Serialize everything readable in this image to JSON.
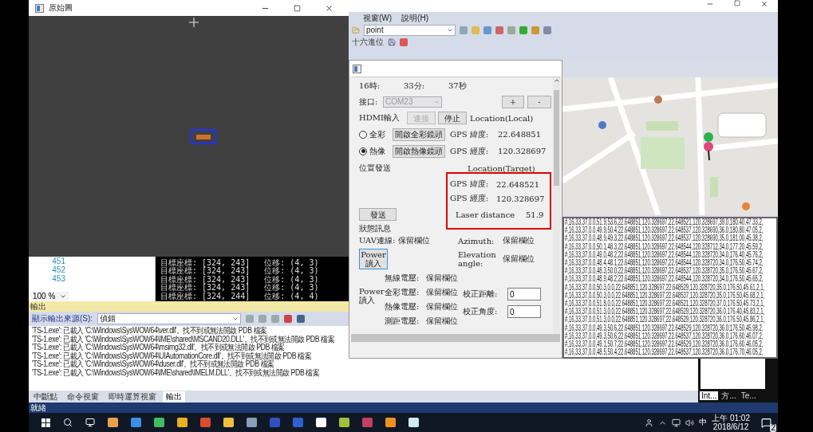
{
  "image_window": {
    "title": "原始圖"
  },
  "editor": {
    "line_numbers": [
      "451",
      "452",
      "453"
    ],
    "zoom": "100 %"
  },
  "console": {
    "lines": [
      "目標座標: [324, 243]   位移: (4, 3)",
      "目標座標: [324, 243]   位移: (4, 3)",
      "目標座標: [324, 243]   位移: (4, 3)",
      "目標座標: [324, 243]   位移: (4, 3)",
      "目標座標: [324, 244]   位移: (4, 4)"
    ]
  },
  "output": {
    "title": "輸出",
    "source_label": "顯示輸出來源(S):",
    "source": "偵錯",
    "lines": [
      "'TS-1.exe': 已載入 'C:\\Windows\\SysWOW64\\ver.dll'。找不到或無法開啟 PDB 檔案",
      "'TS-1.exe': 已載入 'C:\\Windows\\SysWOW64\\IME\\shared\\MSCAND20.DLL'。找不到或無法開啟 PDB 檔案",
      "'TS-1.exe': 已載入 'C:\\Windows\\SysWOW64\\msimg32.dll'。找不到或無法開啟 PDB 檔案",
      "'TS-1.exe': 已載入 'C:\\Windows\\SysWOW64\\UIAutomationCore.dll'。找不到或無法開啟 PDB 檔案",
      "'TS-1.exe': 已載入 'C:\\Windows\\SysWOW64\\duser.dll'。找不到或無法開啟 PDB 檔案",
      "'TS-1.exe': 已載入 'C:\\Windows\\SysWOW64\\IME\\shared\\IMELM.DLL'。找不到或無法開啟 PDB 檔案"
    ]
  },
  "vs": {
    "menu": [
      "視窗(W)",
      "說明(H)"
    ],
    "config": "point",
    "hex_label": "十六進位"
  },
  "dialog": {
    "time": [
      "16時:",
      "33分:",
      "37秒"
    ],
    "port_label": "接口:",
    "port": {
      "value": "COM23",
      "disabled": true
    },
    "plus": "+",
    "minus": "-",
    "hdmi_label": "HDMI輸入",
    "connect": {
      "label": "連接",
      "disabled": true
    },
    "stop": "停止",
    "local_title": "Location(Local)",
    "modes": [
      {
        "label": "全彩",
        "selected": false,
        "button": "開啟全彩鏡頭"
      },
      {
        "label": "熱像",
        "selected": true,
        "button": "開啟熱像鏡頭"
      }
    ],
    "local": [
      {
        "label": "GPS 緯度:",
        "value": "22.648851"
      },
      {
        "label": "GPS 經度:",
        "value": "120.328697"
      }
    ],
    "send_title": "位置發送",
    "target_title": "Location(Target)",
    "target": [
      {
        "label": "GPS 緯度:",
        "value": "22.648521"
      },
      {
        "label": "GPS 經度:",
        "value": "120.328697"
      }
    ],
    "send": "發送",
    "laser_label": "Laser distance",
    "laser": "51.9",
    "status_title": "狀態訊息",
    "azimuth": {
      "label": "Azimuth:",
      "value": "保留欄位"
    },
    "uav": {
      "label": "UAV連線:",
      "value": "保留欄位"
    },
    "elevation": {
      "label": "Elevation angle:",
      "value": "保留欄位"
    },
    "power_button": "Power 讀入",
    "power_label": "Power 讀入",
    "voltages": [
      {
        "label": "無線電壓:",
        "value": "保留欄位"
      },
      {
        "label": "全彩電壓:",
        "value": "保留欄位"
      },
      {
        "label": "熱像電壓:",
        "value": "保留欄位"
      },
      {
        "label": "測距電壓:",
        "value": "保留欄位"
      }
    ],
    "calibration": [
      {
        "label": "校正距離:",
        "value": "0"
      },
      {
        "label": "校正角度:",
        "value": "0"
      }
    ]
  },
  "data_log": {
    "lines": [
      "#,16,33,37,0.0,51.9,53.6,22.648851,120.328697,22.648521,120.328697,39.0,180.40,47.33,2,",
      "#,16,33,37,0.0,49.9,50.4,22.648851,120.328697,22.648537,120.328690,36.0,180.80,47.05,2,",
      "#,16,33,37,0.0,48.9,49.3,22.648851,120.328697,22.648537,120.328690,35.0,181.00,45.38,2,",
      "#,16,33,37,0.0,50.1,48.3,22.648851,120.328697,22.648544,120.328712,34.0,177.20,45.59,2,",
      "#,16,33,37,0.0,49.0,48.2,22.648851,120.328697,22.648544,120.328720,34.0,176.40,45.76,2,",
      "#,16,33,37,0.0,48.4,48.1,22.648851,120.328697,22.648544,120.328720,34.0,176.50,45.74,2,",
      "#,16,33,37,0.0,48.3,50.0,22.648851,120.328697,22.648537,120.328720,35.0,176.50,45.67,2,",
      "#,16,33,37,0.0,48.9,48.2,22.648851,120.328697,22.648544,120.328720,34.0,176.50,45.65,2,",
      "#,16,33,37,0.0,50.3,0.0,22.648851,120.328697,22.648529,120.328720,35.0,176.50,45.61,2,1,",
      "#,16,33,37,0.0,50.3,0.0,22.648851,120.328697,22.648537,120.328720,35.0,176.50,45.68,2,1,",
      "#,16,33,37,0.0,51.8,0.0,22.648851,120.328697,22.648521,120.328720,37.0,176.50,45.73,2,1,",
      "#,16,33,37,0.0,51.3,0.0,22.648851,120.328697,22.648529,120.328720,36.0,176.40,45.83,2,1,",
      "#,16,33,37,0.0,51.3,0.0,22.648851,120.328697,22.648529,120.328720,36.0,176.50,45.86,2,1,",
      "#,16,33,37,0.0,49.3,50.6,22.648851,120.328697,22.648529,120.328720,36.0,176.50,45.98,2,",
      "#,16,33,37,0.0,49.3,50.6,22.648851,120.328697,22.648537,120.328720,36.0,176.60,46.07,2,",
      "#,16,33,37,0.0,49.1,50.7,22.648851,120.328697,22.648529,120.328720,36.0,176.60,46.05,2,",
      "#,16,33,37,0.0,48.5,50.4,22.648851,120.328697,22.648537,120.328720,36.0,176.70,46.05,2,"
    ]
  },
  "bottom_tabs": [
    {
      "label": "中斷點",
      "selected": false
    },
    {
      "label": "命令視窗",
      "selected": false
    },
    {
      "label": "即時運算視窗",
      "selected": false
    },
    {
      "label": "輸出",
      "selected": true
    }
  ],
  "side_tabs": [
    {
      "label": "Int...",
      "selected": true
    },
    {
      "label": "方...",
      "selected": false
    },
    {
      "label": "Te...",
      "selected": false
    }
  ],
  "status_bar": {
    "text": "就緒"
  },
  "taskbar": {
    "ime": "中",
    "time": "上午 01:02",
    "date": "2018/6/12",
    "notifications": "2"
  }
}
